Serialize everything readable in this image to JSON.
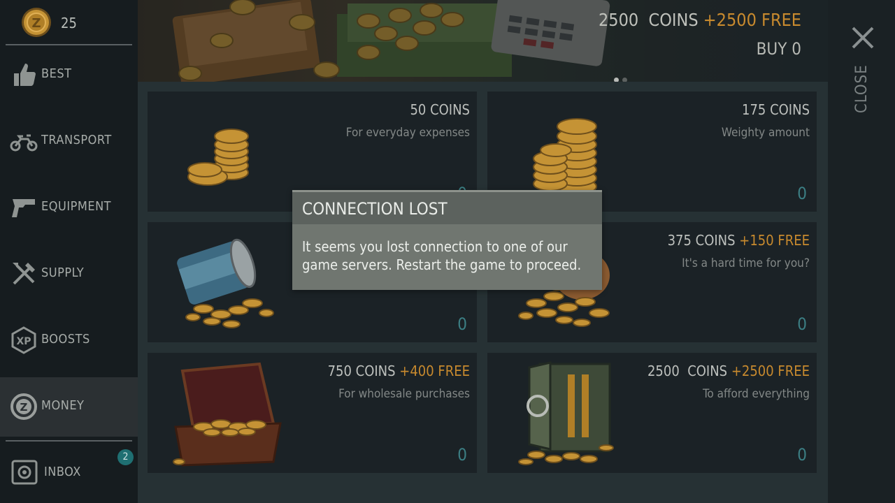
{
  "balance": {
    "amount": "25"
  },
  "sidebar": {
    "items": [
      {
        "label": "BEST"
      },
      {
        "label": "TRANSPORT"
      },
      {
        "label": "EQUIPMENT"
      },
      {
        "label": "SUPPLY"
      },
      {
        "label": "BOOSTS"
      },
      {
        "label": "MONEY"
      },
      {
        "label": "INBOX",
        "badge": "2"
      }
    ]
  },
  "close_label": "CLOSE",
  "banner": {
    "amount": "2500",
    "coins_label": "COINS",
    "free": "+2500 FREE",
    "buy": "BUY 0"
  },
  "offers": [
    {
      "title": "50 COINS",
      "free": "",
      "subtitle": "For everyday expenses",
      "price": "0"
    },
    {
      "title": "175 COINS",
      "free": "",
      "subtitle": "Weighty amount",
      "price": "0"
    },
    {
      "title": "",
      "free": "",
      "subtitle": "",
      "price": "0"
    },
    {
      "title": "375 COINS",
      "free": "+150 FREE",
      "subtitle": "It's a hard time for you?",
      "price": "0"
    },
    {
      "title": "750 COINS",
      "free": "+400 FREE",
      "subtitle": "For wholesale purchases",
      "price": "0"
    },
    {
      "title": "2500  COINS",
      "free": "+2500 FREE",
      "subtitle": "To afford everything",
      "price": "0"
    }
  ],
  "dialog": {
    "title": "CONNECTION LOST",
    "message": "It seems you lost connection to one of our game servers. Restart the game to proceed."
  },
  "colors": {
    "accent_free": "#c88a2e",
    "price": "#3c7f84",
    "badge": "#1f6f72"
  }
}
